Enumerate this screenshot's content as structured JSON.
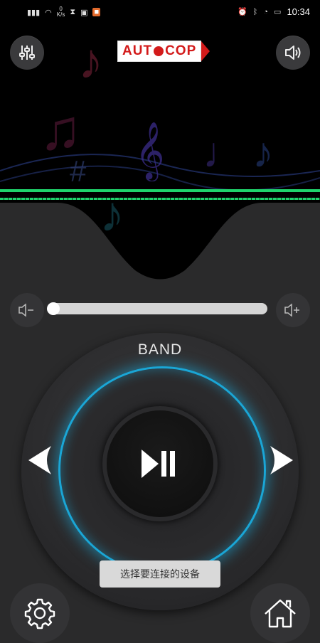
{
  "status_bar": {
    "left_icons": [
      "signal-icon",
      "wifi-icon",
      "data-speed-icon",
      "hourglass-icon",
      "battery-saver-icon",
      "app-icon"
    ],
    "data_speed_value": "0",
    "data_speed_unit": "K/s",
    "right_icons": [
      "alarm-icon",
      "bluetooth-icon",
      "timer-icon",
      "battery-icon"
    ],
    "time": "10:34"
  },
  "header": {
    "logo_left": "AUT",
    "logo_right": "COP",
    "equalizer_icon": "equalizer-icon",
    "speaker_icon": "speaker-icon"
  },
  "volume": {
    "down_icon": "volume-down-icon",
    "up_icon": "volume-up-icon",
    "level": 0
  },
  "dial": {
    "band_label": "BAND",
    "play_pause_icon": "play-pause-icon",
    "prev_icon": "arrow-left-icon",
    "next_icon": "arrow-right-icon",
    "ring_color": "#1aa6d6"
  },
  "toast": {
    "text": "选择要连接的设备"
  },
  "footer": {
    "settings_icon": "gear-icon",
    "home_icon": "home-icon"
  },
  "accent": {
    "equalizer_bar": "#1fd36c",
    "logo_red": "#d31a1a"
  }
}
